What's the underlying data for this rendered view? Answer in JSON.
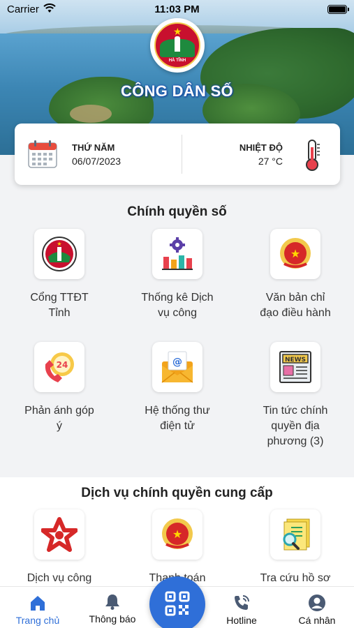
{
  "status_bar": {
    "carrier": "Carrier",
    "time": "11:03 PM"
  },
  "header": {
    "app_title": "CÔNG DÂN SỐ",
    "logo_text": "HÀ TĨNH"
  },
  "info_card": {
    "day_label": "THỨ NĂM",
    "date": "06/07/2023",
    "temp_label": "NHIỆT ĐỘ",
    "temp_value": "27 °C"
  },
  "digital_government": {
    "title": "Chính quyền số",
    "items": [
      {
        "label": "Cổng TTĐT\nTỉnh",
        "icon": "province-emblem-icon"
      },
      {
        "label": "Thống kê Dịch\nvụ công",
        "icon": "statistics-chart-icon"
      },
      {
        "label": "Văn bản chỉ\nđạo điều hành",
        "icon": "national-emblem-icon"
      },
      {
        "label": "Phản ánh góp\ný",
        "icon": "phone-24h-icon"
      },
      {
        "label": "Hệ thống thư\nđiện tử",
        "icon": "email-envelope-icon"
      },
      {
        "label": "Tin tức chính\nquyền địa\nphương (3)",
        "icon": "newspaper-icon"
      }
    ]
  },
  "government_services": {
    "title": "Dịch vụ chính quyền cung cấp",
    "items": [
      {
        "label": "Dịch vụ công",
        "icon": "public-service-logo-icon"
      },
      {
        "label": "Thanh toán",
        "icon": "national-emblem-icon"
      },
      {
        "label": "Tra cứu hồ sơ",
        "icon": "document-search-icon"
      }
    ]
  },
  "bottom_nav": {
    "home": "Trang chủ",
    "notifications": "Thông báo",
    "hotline": "Hotline",
    "profile": "Cá nhân"
  },
  "colors": {
    "accent": "#2f6fd8",
    "emblem_red": "#c8102e",
    "gold": "#f2c94c"
  }
}
